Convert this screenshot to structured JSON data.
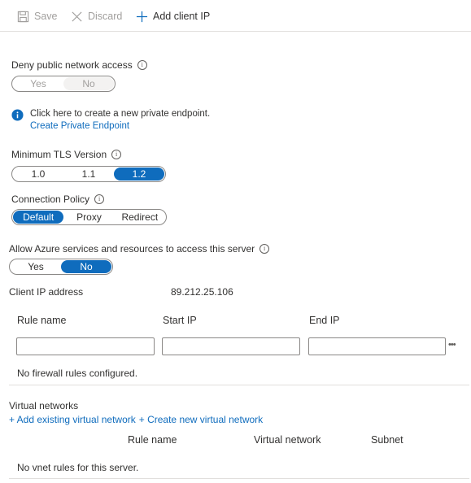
{
  "toolbar": {
    "save_label": "Save",
    "discard_label": "Discard",
    "add_client_ip_label": "Add client IP"
  },
  "deny_public": {
    "label": "Deny public network access",
    "options": [
      "Yes",
      "No"
    ],
    "selected": "No"
  },
  "private_endpoint": {
    "text": "Click here to create a new private endpoint.",
    "link": "Create Private Endpoint"
  },
  "tls": {
    "label": "Minimum TLS Version",
    "options": [
      "1.0",
      "1.1",
      "1.2"
    ],
    "selected": "1.2"
  },
  "connection_policy": {
    "label": "Connection Policy",
    "options": [
      "Default",
      "Proxy",
      "Redirect"
    ],
    "selected": "Default"
  },
  "azure_services": {
    "label": "Allow Azure services and resources to access this server",
    "options": [
      "Yes",
      "No"
    ],
    "selected": "No"
  },
  "client_ip": {
    "label": "Client IP address",
    "value": "89.212.25.106"
  },
  "firewall": {
    "columns": [
      "Rule name",
      "Start IP",
      "End IP"
    ],
    "inputs": {
      "rule_name": "",
      "start_ip": "",
      "end_ip": ""
    },
    "more_label": "•••",
    "empty_message": "No firewall rules configured."
  },
  "vnet": {
    "label": "Virtual networks",
    "add_existing": "+ Add existing virtual network",
    "create_new": "+ Create new virtual network",
    "columns": [
      "Rule name",
      "Virtual network",
      "Subnet"
    ],
    "empty_message": "No vnet rules for this server."
  },
  "colors": {
    "accent": "#0f6cbd",
    "text": "#323130",
    "disabled": "#a19f9d",
    "border": "#8a8886",
    "divider": "#e1dfdd"
  },
  "icons": {
    "save": "save-icon",
    "discard": "close-icon",
    "add": "plus-icon",
    "info": "info-icon",
    "info_filled": "info-filled-icon",
    "more": "more-icon"
  }
}
